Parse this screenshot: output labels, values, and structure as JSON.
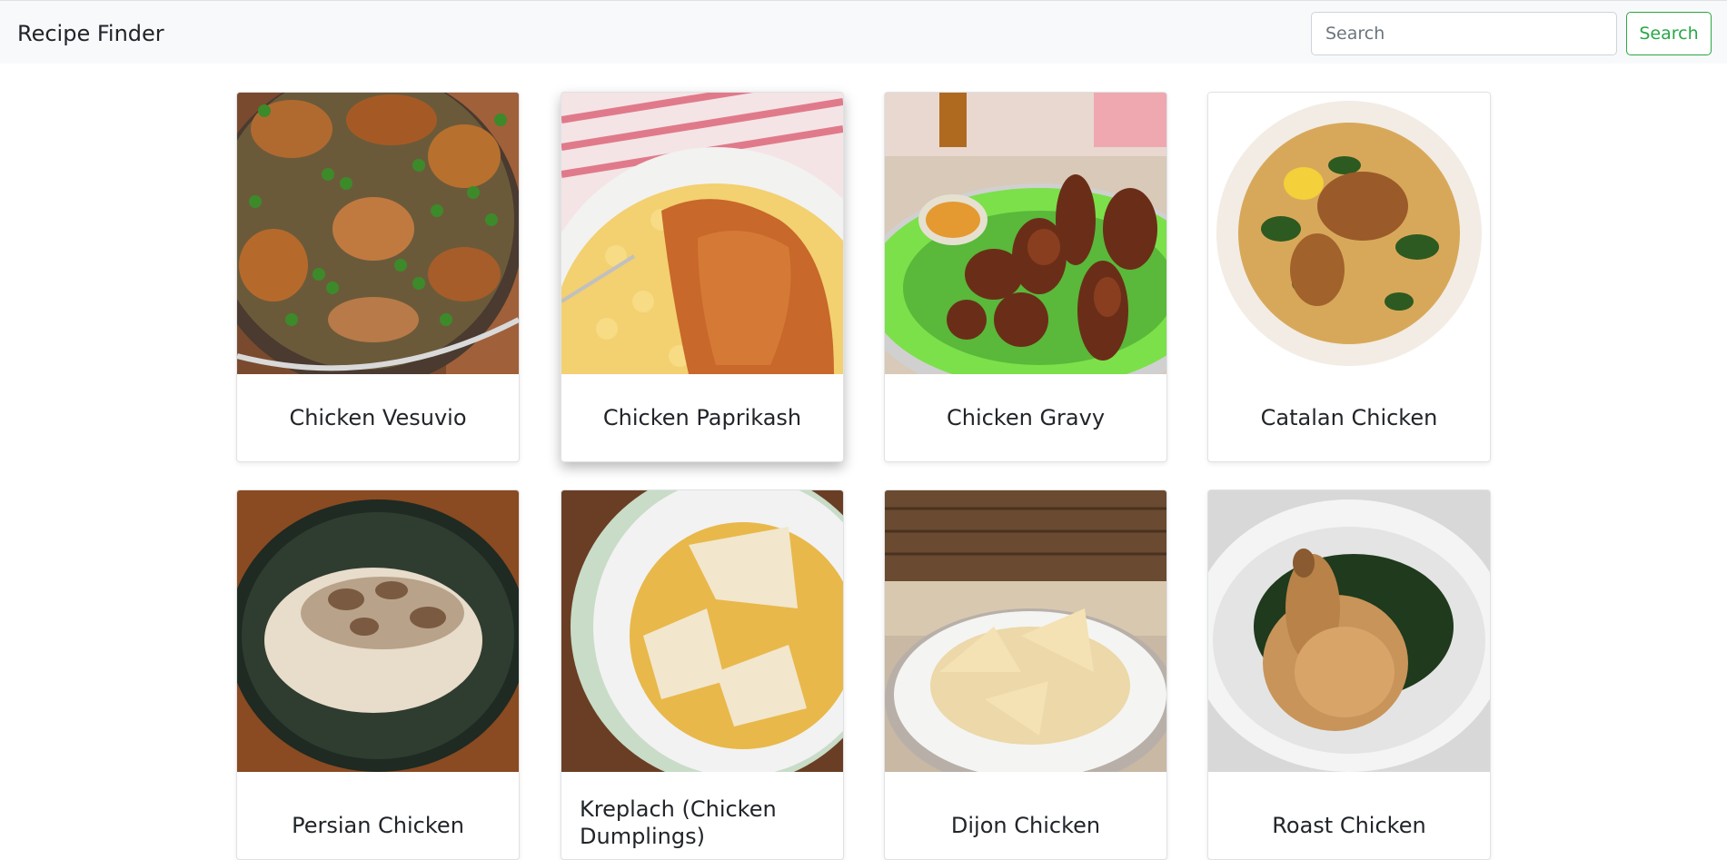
{
  "navbar": {
    "brand": "Recipe Finder",
    "search_placeholder": "Search",
    "search_button": "Search"
  },
  "recipes": [
    {
      "title": "Chicken Vesuvio",
      "image": "chicken-vesuvio-photo"
    },
    {
      "title": "Chicken Paprikash",
      "image": "chicken-paprikash-photo"
    },
    {
      "title": "Chicken Gravy",
      "image": "chicken-gravy-photo"
    },
    {
      "title": "Catalan Chicken",
      "image": "catalan-chicken-photo"
    },
    {
      "title": "Persian Chicken",
      "image": "persian-chicken-photo"
    },
    {
      "title": "Kreplach (Chicken Dumplings)",
      "image": "kreplach-photo"
    },
    {
      "title": "Dijon Chicken",
      "image": "dijon-chicken-photo"
    },
    {
      "title": "Roast Chicken",
      "image": "roast-chicken-photo"
    }
  ],
  "colors": {
    "navbar_bg": "#f8f9fa",
    "accent_green": "#28a745",
    "text_dark": "#212529"
  }
}
